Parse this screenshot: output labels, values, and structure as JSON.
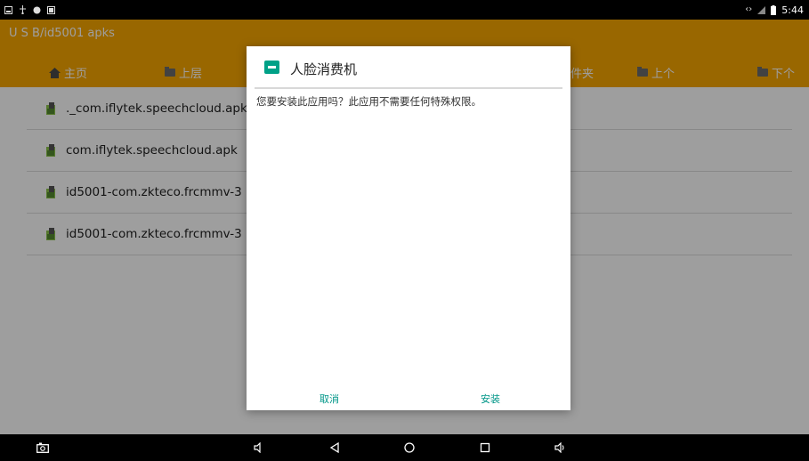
{
  "status_bar": {
    "time": "5:44",
    "left_icons": [
      "screenshot-icon",
      "usb-icon",
      "android-icon",
      "image-icon"
    ],
    "right_icons": [
      "data-sync-icon",
      "wifi-icon",
      "battery-icon"
    ]
  },
  "header": {
    "path": "U S B/id5001 apks",
    "nav": {
      "home": "主页",
      "up": "上层",
      "folder_partial": "件夹",
      "prev": "上个",
      "next": "下个"
    }
  },
  "file_list": [
    {
      "name": "._com.iflytek.speechcloud.apk",
      "icon": "apk-android-icon"
    },
    {
      "name": "com.iflytek.speechcloud.apk",
      "icon": "apk-android-icon"
    },
    {
      "name": "id5001-com.zkteco.frcmmv-3",
      "icon": "apk-android-icon"
    },
    {
      "name": "id5001-com.zkteco.frcmmv-3",
      "icon": "apk-android-icon"
    }
  ],
  "dialog": {
    "title": "人脸消费机",
    "message": "您要安装此应用吗？此应用不需要任何特殊权限。",
    "cancel_label": "取消",
    "install_label": "安装"
  },
  "colors": {
    "header": "#f7a600",
    "accent": "#009688",
    "app_icon": "#00a187"
  }
}
